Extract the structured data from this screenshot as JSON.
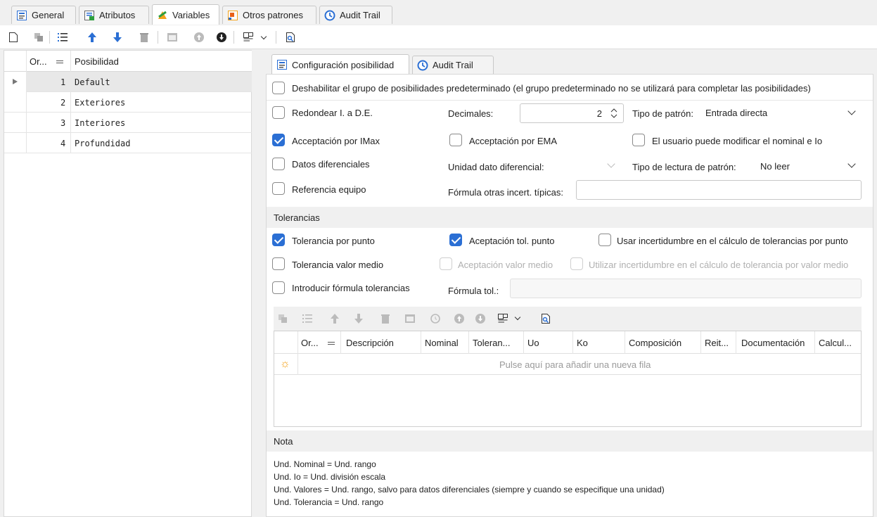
{
  "tabs": [
    {
      "label": "General"
    },
    {
      "label": "Atributos"
    },
    {
      "label": "Variables"
    },
    {
      "label": "Otros patrones"
    },
    {
      "label": "Audit Trail"
    }
  ],
  "left_grid": {
    "headers": {
      "order": "Or...",
      "possibility": "Posibilidad"
    },
    "rows": [
      {
        "order": "1",
        "name": "Default"
      },
      {
        "order": "2",
        "name": "Exteriores"
      },
      {
        "order": "3",
        "name": "Interiores"
      },
      {
        "order": "4",
        "name": "Profundidad"
      }
    ]
  },
  "inner_tabs": [
    {
      "label": "Configuración posibilidad"
    },
    {
      "label": "Audit Trail"
    }
  ],
  "config": {
    "disable_default_label": "Deshabilitar el grupo de posibilidades predeterminado (el grupo predeterminado no se utilizará para completar las posibilidades)",
    "round_label": "Redondear I. a D.E.",
    "decimals_label": "Decimales:",
    "decimals_value": "2",
    "pattern_type_label": "Tipo de patrón:",
    "pattern_type_value": "Entrada directa",
    "accept_imax_label": "Acceptación por IMax",
    "accept_ema_label": "Acceptación por EMA",
    "user_modify_label": "El usuario puede modificar el nominal e Io",
    "diff_data_label": "Datos diferenciales",
    "diff_unit_label": "Unidad dato diferencial:",
    "read_type_label": "Tipo de lectura de patrón:",
    "read_type_value": "No leer",
    "ref_equipment_label": "Referencia equipo",
    "formula_other_label": "Fórmula otras incert. típicas:"
  },
  "tolerances": {
    "section_title": "Tolerancias",
    "tol_point_label": "Tolerancia por punto",
    "accept_tol_point_label": "Aceptación tol. punto",
    "use_uncert_point_label": "Usar incertidumbre en el cálculo de tolerancias por punto",
    "tol_mean_label": "Tolerancia valor medio",
    "accept_mean_label": "Aceptación valor medio",
    "use_uncert_mean_label": "Utilizar incertidumbre en el cálculo de tolerancia por valor medio",
    "enter_formula_label": "Introducir fórmula tolerancias",
    "formula_tol_label": "Fórmula tol.:",
    "grid_headers": [
      "Or...",
      "Descripción",
      "Nominal",
      "Toleran...",
      "Uo",
      "Ko",
      "Composición",
      "Reit...",
      "Documentación",
      "Calcul..."
    ],
    "new_row_hint": "Pulse aquí para añadir una nueva fila"
  },
  "note": {
    "section_title": "Nota",
    "lines": [
      "Und. Nominal = Und. rango",
      "Und. Io = Und. división escala",
      "Und. Valores = Und. rango, salvo para datos diferenciales (siempre y cuando se especifique una unidad)",
      "Und. Tolerancia = Und. rango"
    ]
  },
  "colors": {
    "accent": "#2b6fd4",
    "selected_row": "#e8e8e8",
    "section_bg": "#f0f0f0"
  }
}
